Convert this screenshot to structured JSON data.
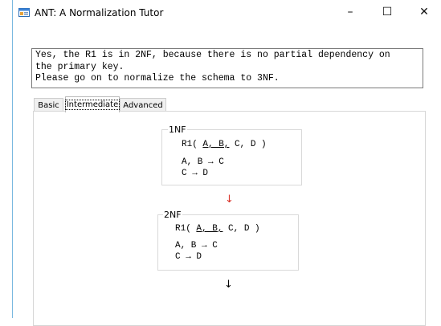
{
  "window": {
    "title": "ANT: A Normalization Tutor",
    "controls": {
      "minimize_glyph": "–",
      "maximize_glyph": "☐",
      "close_glyph": "✕"
    }
  },
  "message": {
    "lines": [
      "Yes, the R1 is in 2NF, because there is no partial dependency on",
      "the primary key.",
      "Please go on to normalize the schema to 3NF."
    ]
  },
  "tabs": [
    {
      "label": "Basic",
      "active": false
    },
    {
      "label": "Intermediate",
      "active": true
    },
    {
      "label": "Advanced",
      "active": false
    }
  ],
  "stages": [
    {
      "label": "1NF",
      "relation": {
        "name": "R1",
        "open": "( ",
        "key_attrs": "A, B,",
        "other_attrs": " C, D )"
      },
      "dependencies": [
        "A, B → C",
        "C → D"
      ],
      "arrow_after": "↓",
      "arrow_color": "#d9332a"
    },
    {
      "label": "2NF",
      "relation": {
        "name": "R1",
        "open": "( ",
        "key_attrs": "A, B,",
        "other_attrs": " C, D )"
      },
      "dependencies": [
        "A, B → C",
        "C → D"
      ],
      "arrow_after": "↓",
      "arrow_color": "#000000"
    }
  ],
  "icons": {
    "app": "app-window-icon"
  }
}
